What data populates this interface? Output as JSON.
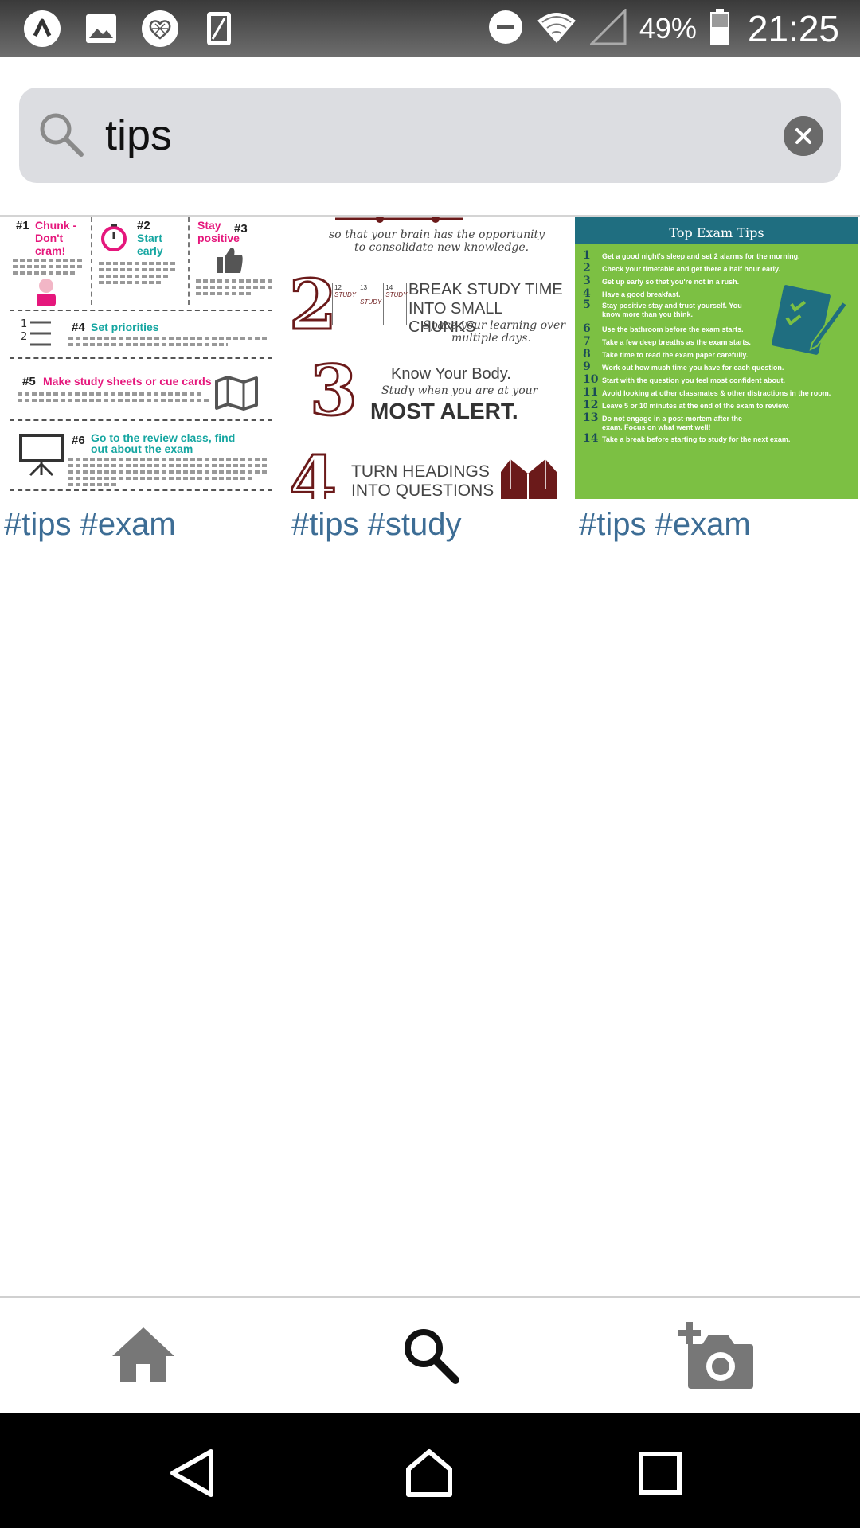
{
  "status_bar": {
    "left_icons": [
      "app-a-icon",
      "gallery-icon",
      "heart-badge-icon",
      "tablet-icon"
    ],
    "right_icons": [
      "do-not-disturb-icon",
      "wifi-icon",
      "cellular-icon",
      "battery-icon"
    ],
    "battery": "49%",
    "time": "21:25"
  },
  "search": {
    "value": "tips",
    "icon": "search-icon",
    "clear_icon": "clear-icon"
  },
  "results": [
    {
      "tags": "#tips #exam",
      "thumb": {
        "items": [
          {
            "num": "#1",
            "label": "Chunk - Don't cram!"
          },
          {
            "num": "#2",
            "label": "Start early"
          },
          {
            "num": "#3",
            "label": "Stay positive"
          },
          {
            "num": "#4",
            "label": "Set priorities"
          },
          {
            "num": "#5",
            "label": "Make study sheets or cue cards"
          },
          {
            "num": "#6",
            "label": "Go to the review class, find out about the exam"
          }
        ]
      }
    },
    {
      "tags": "#tips #study",
      "thumb": {
        "top_line1": "so that your brain has the opportunity",
        "top_line2": "to consolidate new knowledge.",
        "n2": "2",
        "s2_line1": "BREAK STUDY TIME",
        "s2_line2": "INTO SMALL CHUNKS",
        "s2_sub1": "Space your learning over",
        "s2_sub2": "multiple days.",
        "cal_days": [
          "12",
          "13",
          "14"
        ],
        "cal_word": "STUDY",
        "n3": "3",
        "s3_line1": "Know Your Body.",
        "s3_sub": "Study when you are at your",
        "s3_line2": "MOST ALERT.",
        "n4": "4",
        "s4_line1": "TURN HEADINGS",
        "s4_line2": "INTO QUESTIONS"
      }
    },
    {
      "tags": "#tips #exam",
      "thumb": {
        "title": "Top Exam Tips",
        "tips": [
          {
            "n": "1",
            "t": "Get a good night's sleep and set 2 alarms for the morning."
          },
          {
            "n": "2",
            "t": "Check your timetable and get there a half hour early."
          },
          {
            "n": "3",
            "t": "Get up early so that you're not in a rush."
          },
          {
            "n": "4",
            "t": "Have a good breakfast."
          },
          {
            "n": "5",
            "t": "Stay positive stay and trust yourself. You know more than you think."
          },
          {
            "n": "6",
            "t": "Use the bathroom before the exam starts."
          },
          {
            "n": "7",
            "t": "Take a few deep breaths as the exam starts."
          },
          {
            "n": "8",
            "t": "Take time to read the exam paper carefully."
          },
          {
            "n": "9",
            "t": "Work out how much time you have for each question."
          },
          {
            "n": "10",
            "t": "Start with the question you feel most confident about."
          },
          {
            "n": "11",
            "t": "Avoid looking at other classmates & other distractions in the room."
          },
          {
            "n": "12",
            "t": "Leave 5 or 10 minutes at the end of the exam to review."
          },
          {
            "n": "13",
            "t": "Do not engage in a post-mortem after the exam. Focus on what went well!"
          },
          {
            "n": "14",
            "t": "Take a break before starting to study for the next exam."
          }
        ]
      }
    }
  ],
  "bottom_nav": {
    "items": [
      "home-icon",
      "search-icon",
      "add-photo-icon"
    ],
    "active": "search-icon"
  },
  "system_nav": [
    "back-icon",
    "home-icon",
    "recents-icon"
  ],
  "colors": {
    "status_bar": "#555555",
    "search_box": "#dcdde1",
    "tag_link": "#3d6d95",
    "green_card": "#7cc043",
    "card_header": "#1f6e80",
    "maroon": "#6b1a1a"
  }
}
